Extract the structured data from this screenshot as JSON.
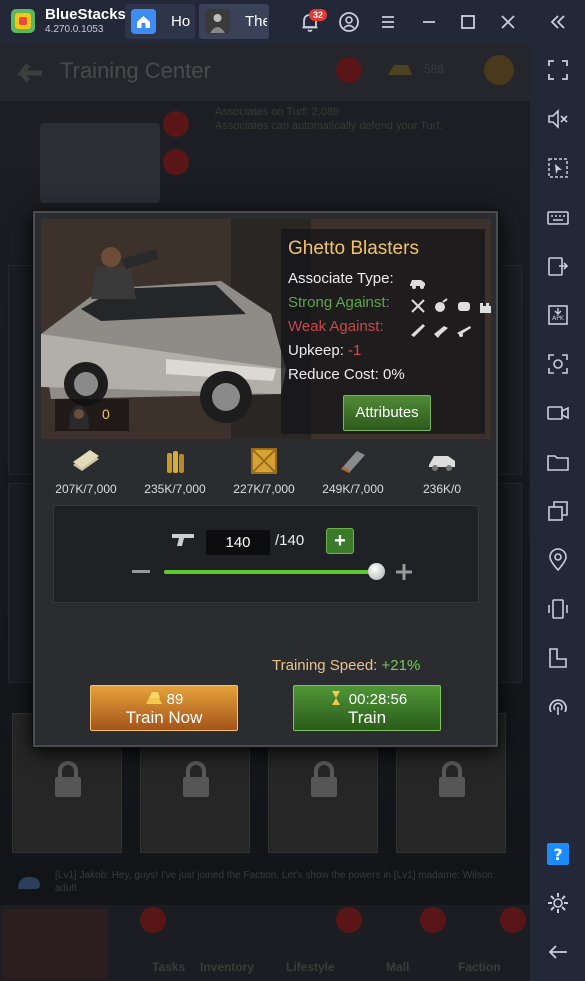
{
  "titlebar": {
    "app_name": "BlueStacks",
    "version": "4.270.0.1053",
    "tabs": [
      {
        "label": "Ho",
        "icon": "home-icon"
      },
      {
        "label": "The",
        "icon": "game-icon"
      }
    ],
    "notification_count": "32"
  },
  "sidebar": {
    "icons": [
      "fullscreen-icon",
      "volume-icon",
      "cursor-icon",
      "keyboard-icon",
      "install-apk-icon",
      "apk-icon",
      "screenshot-icon",
      "record-icon",
      "folder-icon",
      "multi-instance-icon",
      "location-icon",
      "shake-icon",
      "rotate-icon",
      "macro-icon",
      "help-icon",
      "settings-icon",
      "back-icon"
    ]
  },
  "background": {
    "title": "Training Center",
    "info_line1": "Associates on Turf: 2,089",
    "info_line2": "Associates can automatically defend your Turf.",
    "currency": "588",
    "chat_text": "[Lv1] Jakob: Hey, guys! I've just joined the Faction. Let's show the powers in [Lv1] madame: Wilson: adult",
    "bottom_tabs": [
      "Tasks",
      "Inventory",
      "Lifestyle",
      "Mall",
      "Faction"
    ]
  },
  "dialog": {
    "unit_name": "Ghetto Blasters",
    "associate_type_label": "Associate Type:",
    "strong_against_label": "Strong Against:",
    "weak_against_label": "Weak Against:",
    "upkeep_label": "Upkeep: ",
    "upkeep_value": "-1",
    "reduce_cost_label": "Reduce Cost: 0%",
    "attributes_button": "Attributes",
    "associate_count": "0",
    "resources": [
      {
        "icon": "cash-icon",
        "value": "207K/7,000"
      },
      {
        "icon": "ammo-icon",
        "value": "235K/7,000"
      },
      {
        "icon": "supply-crate-icon",
        "value": "227K/7,000"
      },
      {
        "icon": "metal-icon",
        "value": "249K/7,000"
      },
      {
        "icon": "vehicle-part-icon",
        "value": "236K/0"
      }
    ],
    "quantity": "140",
    "quantity_max": "/140",
    "slider_fraction": 1.0,
    "training_speed_label": "Training Speed: ",
    "training_speed_value": "+21%",
    "train_now": {
      "gold_cost": "89",
      "label": "Train Now"
    },
    "train": {
      "time": "00:28:56",
      "label": "Train"
    }
  }
}
